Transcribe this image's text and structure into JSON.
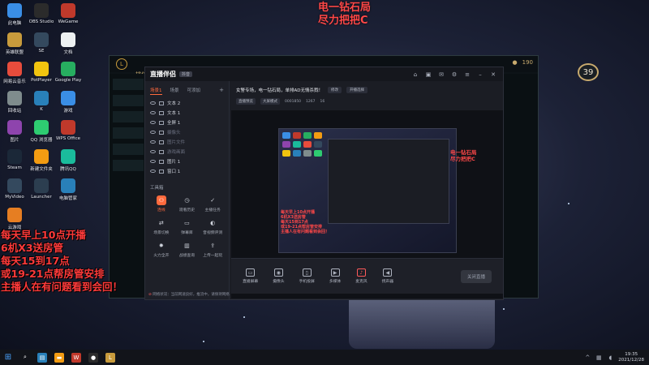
{
  "stream_title": [
    "电一钻石局",
    "尽力把把C"
  ],
  "overlay_lines": [
    "每天早上10点开播",
    "6机X3送房管",
    "每天15到17点",
    "或19-21点帮房管安排",
    "主播人在有问题看到会回！"
  ],
  "desktop_icons": [
    {
      "label": "此电脑",
      "icon": "computer-icon",
      "color": "#3a8ee6"
    },
    {
      "label": "OBS Studio",
      "icon": "obs-icon",
      "color": "#2b2b2b"
    },
    {
      "label": "WeGame",
      "icon": "wegame-icon",
      "color": "#c0392b"
    },
    {
      "label": "英雄联盟",
      "icon": "lol-icon",
      "color": "#c89b3c"
    },
    {
      "label": "SE",
      "icon": "se-icon",
      "color": "#34495e"
    },
    {
      "label": "文档",
      "icon": "document-icon",
      "color": "#ecf0f1"
    },
    {
      "label": "网易云音乐",
      "icon": "music-icon",
      "color": "#e74c3c"
    },
    {
      "label": "PotPlayer",
      "icon": "player-icon",
      "color": "#f1c40f"
    },
    {
      "label": "Google Play",
      "icon": "play-icon",
      "color": "#27ae60"
    },
    {
      "label": "回收站",
      "icon": "recycle-icon",
      "color": "#7f8c8d"
    },
    {
      "label": "K",
      "icon": "k-icon",
      "color": "#2980b9"
    },
    {
      "label": "游戏",
      "icon": "game-icon",
      "color": "#3a8ee6"
    },
    {
      "label": "图片",
      "icon": "image-icon",
      "color": "#8e44ad"
    },
    {
      "label": "QQ 浏览器",
      "icon": "qq-browser-icon",
      "color": "#2ecc71"
    },
    {
      "label": "WPS Office",
      "icon": "wps-icon",
      "color": "#c0392b"
    },
    {
      "label": "Steam",
      "icon": "steam-icon",
      "color": "#1b2838"
    },
    {
      "label": "新建文件夹",
      "icon": "folder-icon",
      "color": "#f39c12"
    },
    {
      "label": "腾讯QQ",
      "icon": "qq-icon",
      "color": "#1abc9c"
    },
    {
      "label": "MyVideo",
      "icon": "video-icon",
      "color": "#34495e"
    },
    {
      "label": "Launcher",
      "icon": "launcher-icon",
      "color": "#2c3e50"
    },
    {
      "label": "电脑管家",
      "icon": "shield-icon",
      "color": "#2980b9"
    },
    {
      "label": "云游戏",
      "icon": "cloud-game-icon",
      "color": "#e67e22"
    }
  ],
  "app": {
    "logo": "直播伴侣",
    "badge": "抖音",
    "tabs": [
      "场景1",
      "场景",
      "可添加"
    ],
    "sources": [
      {
        "label": "文本 2",
        "dim": false
      },
      {
        "label": "文本 1",
        "dim": false
      },
      {
        "label": "全屏 1",
        "dim": false
      },
      {
        "label": "摄像头",
        "dim": true
      },
      {
        "label": "图片文件",
        "dim": true
      },
      {
        "label": "游戏画面",
        "dim": true
      },
      {
        "label": "图片 1",
        "dim": false
      },
      {
        "label": "窗口 1",
        "dim": false
      }
    ],
    "toolbox_label": "工具箱",
    "tools": [
      {
        "label": "连线",
        "icon": "link-icon",
        "orange": true
      },
      {
        "label": "观看历史",
        "icon": "history-icon",
        "orange": false
      },
      {
        "label": "主播任务",
        "icon": "task-icon",
        "orange": false
      },
      {
        "label": "场景切换",
        "icon": "switch-icon",
        "orange": false
      },
      {
        "label": "弹幕库",
        "icon": "danmu-icon",
        "orange": false
      },
      {
        "label": "音视频评测",
        "icon": "test-icon",
        "orange": false
      },
      {
        "label": "火力全开",
        "icon": "fire-icon",
        "orange": false
      },
      {
        "label": "战绩查询",
        "icon": "stats-icon",
        "orange": false
      },
      {
        "label": "上传一起玩",
        "icon": "upload-icon",
        "orange": false
      }
    ],
    "room_title": "女警专场，电一钻石局，单排AD无情杀戮！",
    "room_chips": [
      "修改",
      "开播选择"
    ],
    "room_meta": [
      "直播预览",
      "大屏模式",
      "0001850",
      "1267",
      "16"
    ],
    "bottom_tools": [
      {
        "label": "直播屏幕",
        "icon": "screen-icon"
      },
      {
        "label": "摄像头",
        "icon": "camera-icon"
      },
      {
        "label": "手机投屏",
        "icon": "phone-icon"
      },
      {
        "label": "多媒体",
        "icon": "media-icon"
      },
      {
        "label": "麦克风",
        "icon": "mic-icon",
        "red": true
      },
      {
        "label": "扬声器",
        "icon": "speaker-icon"
      }
    ],
    "start_button": "关闭直播",
    "status_text": "网络状况：当前网速良好，推流中，请保持网络"
  },
  "lol": {
    "rank_label": "排位赛",
    "level": "39"
  },
  "clock": {
    "time": "19:35",
    "date": "2021/12/28"
  }
}
